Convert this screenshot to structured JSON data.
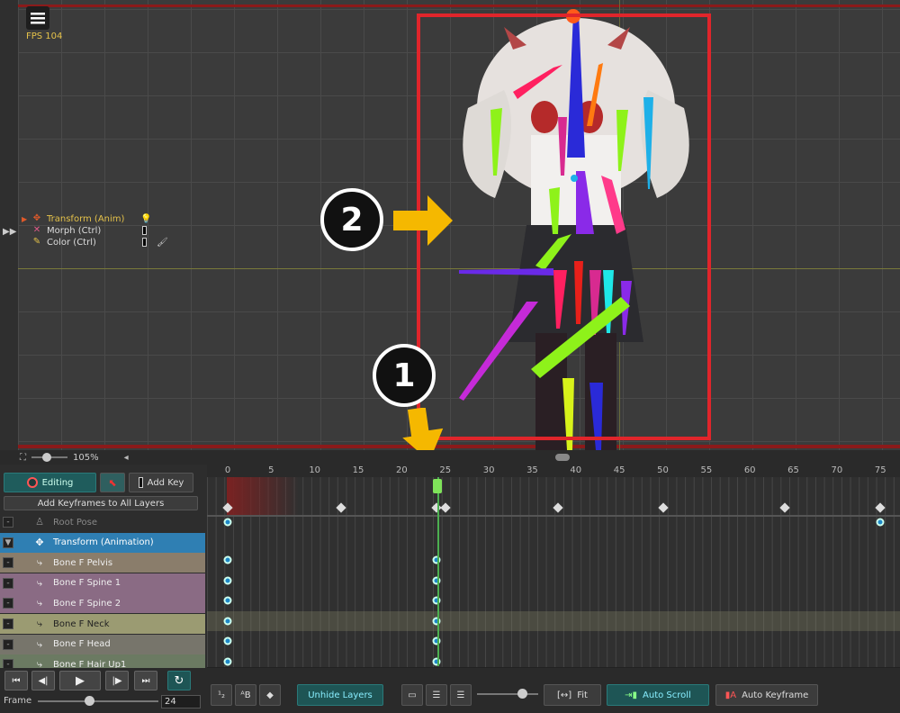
{
  "viewport": {
    "fps_label": "FPS 104",
    "zoom_label": "105%",
    "layer_options": [
      {
        "label": "Transform (Anim)",
        "icon": "transform-icon",
        "color": "#e5c24a"
      },
      {
        "label": "Morph (Ctrl)",
        "icon": "morph-icon",
        "color": "#dddddd"
      },
      {
        "label": "Color (Ctrl)",
        "icon": "color-icon",
        "color": "#dddddd"
      }
    ]
  },
  "annotations": {
    "step1": "1",
    "step2": "2",
    "highlight_color": "#e0252b",
    "arrow_color": "#f5b800"
  },
  "animation_panel": {
    "editing_label": "Editing",
    "add_key_label": "Add Key",
    "add_keyframes_all_label": "Add Keyframes to All Layers",
    "layers": [
      {
        "name": "Root Pose",
        "icon": "root-pose-icon",
        "row_color": "#2d2d2d",
        "text_color": "#888888",
        "toggle": "-"
      },
      {
        "name": "Transform (Animation)",
        "icon": "transform-animation-icon",
        "row_color": "#2f7fb3",
        "text_color": "#ffffff",
        "toggle": "▼"
      },
      {
        "name": "Bone F Pelvis",
        "icon": "bone-icon",
        "row_color": "#8a7d6b",
        "text_color": "#eeeeee",
        "toggle": "-"
      },
      {
        "name": "Bone F Spine 1",
        "icon": "bone-icon",
        "row_color": "#8a6b84",
        "text_color": "#eeeeee",
        "toggle": "-"
      },
      {
        "name": "Bone F Spine 2",
        "icon": "bone-icon",
        "row_color": "#8a6b84",
        "text_color": "#eeeeee",
        "toggle": "-"
      },
      {
        "name": "Bone F Neck",
        "icon": "bone-icon",
        "row_color": "#9b9b72",
        "text_color": "#222222",
        "toggle": "-"
      },
      {
        "name": "Bone F Head",
        "icon": "bone-icon",
        "row_color": "#77756b",
        "text_color": "#eeeeee",
        "toggle": "-"
      },
      {
        "name": "Bone F Hair Up1",
        "icon": "bone-icon",
        "row_color": "#6b7a62",
        "text_color": "#eeeeee",
        "toggle": "-"
      }
    ],
    "frame_label": "Frame",
    "frame_value": "24"
  },
  "timeline": {
    "ruler_labels": [
      "0",
      "5",
      "10",
      "15",
      "20",
      "25",
      "30",
      "35",
      "40",
      "45",
      "50",
      "55",
      "60",
      "65",
      "70",
      "75"
    ],
    "current_frame": 24,
    "summary_keyframes": [
      0,
      13,
      24,
      25,
      38,
      50,
      64,
      75
    ],
    "start_end_frames": [
      0,
      75
    ],
    "bone_keyframes": [
      0,
      24
    ]
  },
  "bottom_bar": {
    "unhide_layers_label": "Unhide Layers",
    "fit_label": "Fit",
    "auto_scroll_label": "Auto Scroll",
    "auto_keyframe_label": "Auto Keyframe"
  }
}
